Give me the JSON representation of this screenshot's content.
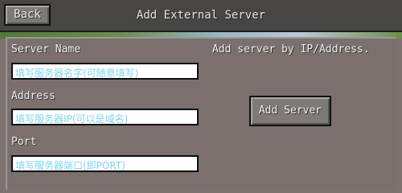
{
  "header": {
    "back_label": "Back",
    "title": "Add External Server"
  },
  "form": {
    "server_name": {
      "label": "Server Name",
      "value": "",
      "placeholder": "填写服务器名字(可随意填写)"
    },
    "address": {
      "label": "Address",
      "value": "",
      "placeholder": "填写服务器IP(可以是域名)"
    },
    "port": {
      "label": "Port",
      "value": "",
      "placeholder": "填写服务器端口(即PORT)"
    }
  },
  "hint": "Add server by IP/Address.",
  "add_button_label": "Add Server",
  "colors": {
    "placeholder_text": "#7fd4ef",
    "panel_bg": "#7b706e",
    "header_bg": "#484545"
  }
}
